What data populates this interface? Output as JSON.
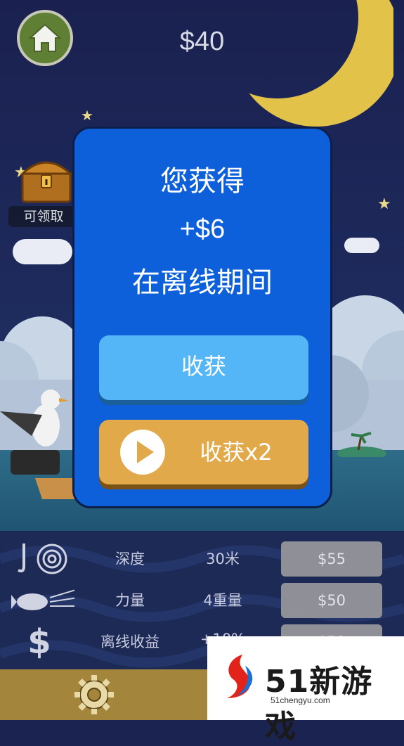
{
  "hud": {
    "money": "$40"
  },
  "chest": {
    "claim_label": "可领取"
  },
  "dialog": {
    "line1": "您获得",
    "line2": "+$6",
    "line3": "在离线期间",
    "collect_label": "收获",
    "collect_double_label": "收获x2"
  },
  "upgrades": [
    {
      "icon": "hook-spiral-icon",
      "name": "深度",
      "value": "30米",
      "price": "$55"
    },
    {
      "icon": "fish-speed-icon",
      "name": "力量",
      "value": "4重量",
      "price": "$50"
    },
    {
      "icon": "dollar-icon",
      "name": "离线收益",
      "value": "+10%",
      "price": "$50"
    }
  ],
  "watermark": {
    "brand": "51新游戏",
    "url": "51chengyu.com"
  },
  "colors": {
    "dialog_bg": "#0d5fda",
    "collect_button": "#55b6f7",
    "collect_double_button": "#e1a94a",
    "upgrade_button": "#8e8f97",
    "bottom_bar": "#a3853b"
  }
}
